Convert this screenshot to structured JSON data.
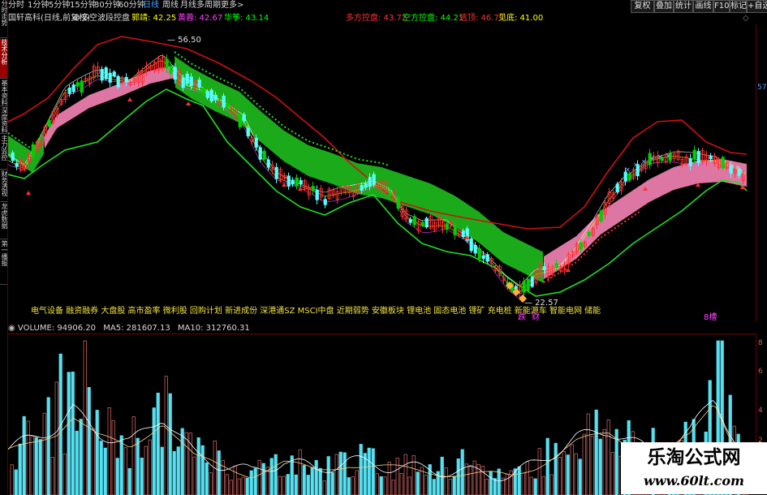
{
  "left_tabs": [
    {
      "label": "分时走势",
      "active": false
    },
    {
      "label": "技术分析",
      "active": true
    },
    {
      "label": "基本资料",
      "active": false
    },
    {
      "label": "深度资料",
      "active": false
    },
    {
      "label": "主力监控",
      "active": false
    },
    {
      "label": "财务透视",
      "active": false
    },
    {
      "label": "龙虎数据",
      "active": false
    },
    {
      "label": "第一播报",
      "active": false
    }
  ],
  "toolbar": {
    "periods": [
      "分时",
      "1分钟",
      "5分钟",
      "15分钟",
      "30分钟",
      "60分钟",
      "日线",
      "周线",
      "月线",
      "多周期",
      "更多>"
    ],
    "active_period": "日线",
    "buttons": [
      "复权",
      "叠加",
      "统计",
      "画线",
      "F10",
      "标记",
      "+自选"
    ]
  },
  "info": {
    "stock_name": "国轩高科(日线,前复权)",
    "indicator_name": "多空波段控盘",
    "labels": [
      {
        "text": "郭靖: 42.25",
        "color": "#ffff00"
      },
      {
        "text": "黄蓉: 42.67",
        "color": "#ff40ff"
      },
      {
        "text": "华筝: 43.14",
        "color": "#00ff00"
      },
      {
        "text": "多方控盘: 43.72",
        "color": "#ff3030"
      },
      {
        "text": "空方控盘: 44.21",
        "color": "#00ff00"
      },
      {
        "text": "逃顶: 46.77",
        "color": "#ff3030"
      },
      {
        "text": "见底: 41.00",
        "color": "#ffff00"
      }
    ]
  },
  "chart_labels": {
    "high_price": "56.50",
    "low_price": "22.57",
    "right_axis_value": "57",
    "markers": [
      "跌",
      "财",
      "8槽"
    ]
  },
  "concepts": "电气设备 融资融券 大盘股 高市盈率 微利股 回购计划 新进成份 深港通SZ MSCI中盘 近期弱势 安徽板块 锂电池 固态电池 锂矿 充电桩 新能源车 智能电网 储能",
  "volume": {
    "label": "VOLUME: 94906.20",
    "ma5": "MA5: 281607.13",
    "ma10": "MA10: 312760.31",
    "axis_ticks": [
      "8",
      "6",
      "4",
      "2"
    ]
  },
  "watermark": {
    "title": "乐淘公式网",
    "url": "www.60lt.com"
  },
  "colors": {
    "up": "#ff3030",
    "down": "#54ffff",
    "bull_band": "#f080b0",
    "bear_band": "#1cb81c",
    "upper_line": "#d01010",
    "lower_line": "#20e020"
  }
}
